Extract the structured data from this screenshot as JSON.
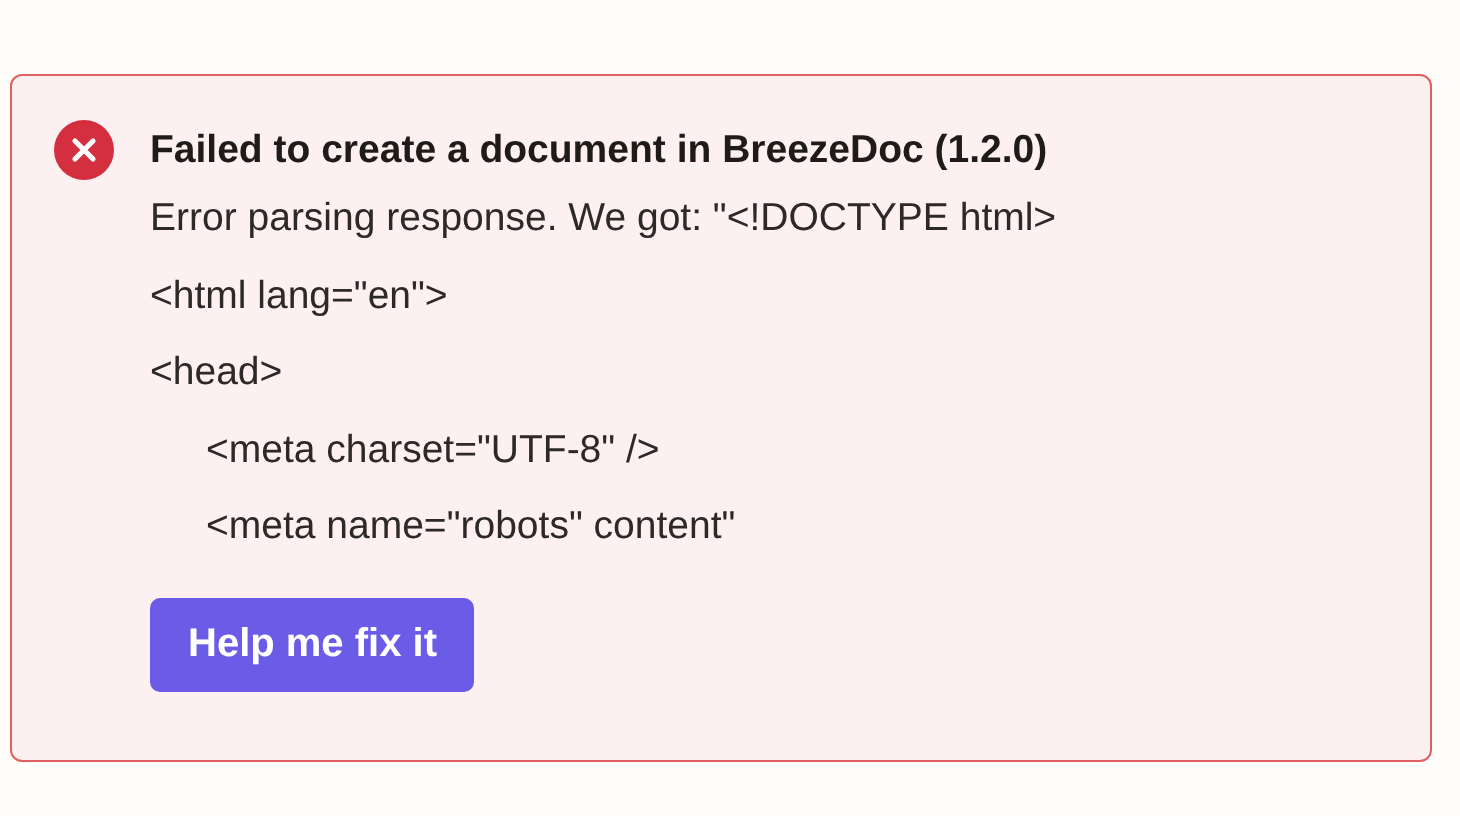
{
  "alert": {
    "kind": "error",
    "title": "Failed to create a document in BreezeDoc (1.2.0)",
    "message": "Error parsing response. We got: \"<!DOCTYPE html>",
    "lines": [
      {
        "text": "<html lang=\"en\">"
      },
      {
        "text": "<head>",
        "children": [
          {
            "text": "<meta charset=\"UTF-8\" />"
          },
          {
            "text": "<meta name=\"robots\" content\""
          }
        ]
      }
    ],
    "button": "Help me fix it"
  }
}
